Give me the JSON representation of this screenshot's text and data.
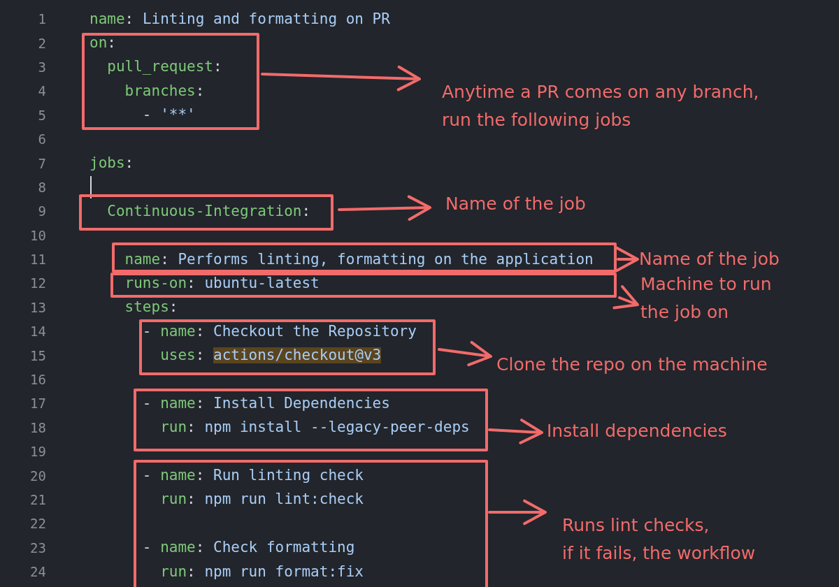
{
  "editor": {
    "lines": [
      {
        "number": "1",
        "tokens": [
          {
            "kind": "key",
            "text": "name"
          },
          {
            "kind": "punct",
            "text": ": "
          },
          {
            "kind": "value",
            "text": "Linting and formatting on PR"
          }
        ]
      },
      {
        "number": "2",
        "tokens": [
          {
            "kind": "key",
            "text": "on"
          },
          {
            "kind": "punct",
            "text": ":"
          }
        ]
      },
      {
        "number": "3",
        "tokens": [
          {
            "kind": "key",
            "text": "  pull_request"
          },
          {
            "kind": "punct",
            "text": ":"
          }
        ]
      },
      {
        "number": "4",
        "tokens": [
          {
            "kind": "key",
            "text": "    branches"
          },
          {
            "kind": "punct",
            "text": ":"
          }
        ]
      },
      {
        "number": "5",
        "tokens": [
          {
            "kind": "punct",
            "text": "      - "
          },
          {
            "kind": "value",
            "text": "'**'"
          }
        ]
      },
      {
        "number": "6"
      },
      {
        "number": "7",
        "tokens": [
          {
            "kind": "key",
            "text": "jobs"
          },
          {
            "kind": "punct",
            "text": ":"
          }
        ]
      },
      {
        "number": "8",
        "cursor": true
      },
      {
        "number": "9",
        "tokens": [
          {
            "kind": "key",
            "text": "  Continuous-Integration"
          },
          {
            "kind": "punct",
            "text": ":"
          }
        ]
      },
      {
        "number": "10"
      },
      {
        "number": "11",
        "tokens": [
          {
            "kind": "key",
            "text": "    name"
          },
          {
            "kind": "punct",
            "text": ": "
          },
          {
            "kind": "value",
            "text": "Performs linting, formatting on the application"
          }
        ]
      },
      {
        "number": "12",
        "tokens": [
          {
            "kind": "key",
            "text": "    runs-on"
          },
          {
            "kind": "punct",
            "text": ": "
          },
          {
            "kind": "value",
            "text": "ubuntu-latest"
          }
        ]
      },
      {
        "number": "13",
        "tokens": [
          {
            "kind": "key",
            "text": "    steps"
          },
          {
            "kind": "punct",
            "text": ":"
          }
        ]
      },
      {
        "number": "14",
        "tokens": [
          {
            "kind": "punct",
            "text": "      - "
          },
          {
            "kind": "key",
            "text": "name"
          },
          {
            "kind": "punct",
            "text": ": "
          },
          {
            "kind": "value",
            "text": "Checkout the Repository"
          }
        ]
      },
      {
        "number": "15",
        "tokens": [
          {
            "kind": "key",
            "text": "        uses"
          },
          {
            "kind": "punct",
            "text": ": "
          },
          {
            "kind": "value",
            "text": "actions/checkout@v3",
            "highlighted": true
          }
        ]
      },
      {
        "number": "16"
      },
      {
        "number": "17",
        "tokens": [
          {
            "kind": "punct",
            "text": "      - "
          },
          {
            "kind": "key",
            "text": "name"
          },
          {
            "kind": "punct",
            "text": ": "
          },
          {
            "kind": "value",
            "text": "Install Dependencies"
          }
        ]
      },
      {
        "number": "18",
        "tokens": [
          {
            "kind": "key",
            "text": "        run"
          },
          {
            "kind": "punct",
            "text": ": "
          },
          {
            "kind": "value",
            "text": "npm install --legacy-peer-deps"
          }
        ]
      },
      {
        "number": "19"
      },
      {
        "number": "20",
        "tokens": [
          {
            "kind": "punct",
            "text": "      - "
          },
          {
            "kind": "key",
            "text": "name"
          },
          {
            "kind": "punct",
            "text": ": "
          },
          {
            "kind": "value",
            "text": "Run linting check"
          }
        ]
      },
      {
        "number": "21",
        "tokens": [
          {
            "kind": "key",
            "text": "        run"
          },
          {
            "kind": "punct",
            "text": ": "
          },
          {
            "kind": "value",
            "text": "npm run lint:check"
          }
        ]
      },
      {
        "number": "22"
      },
      {
        "number": "23",
        "tokens": [
          {
            "kind": "punct",
            "text": "      - "
          },
          {
            "kind": "key",
            "text": "name"
          },
          {
            "kind": "punct",
            "text": ": "
          },
          {
            "kind": "value",
            "text": "Check formatting"
          }
        ]
      },
      {
        "number": "24",
        "tokens": [
          {
            "kind": "key",
            "text": "        run"
          },
          {
            "kind": "punct",
            "text": ": "
          },
          {
            "kind": "value",
            "text": "npm run format:fix"
          }
        ]
      }
    ]
  },
  "annotations": [
    {
      "lines": [
        "Anytime a PR comes on any branch,",
        "run the following jobs"
      ]
    },
    {
      "lines": [
        "Name of the job"
      ]
    },
    {
      "lines": [
        "Name of the job"
      ]
    },
    {
      "lines": [
        "Machine to run",
        "the job on"
      ]
    },
    {
      "lines": [
        "Clone the repo on the machine"
      ]
    },
    {
      "lines": [
        "Install dependencies"
      ]
    },
    {
      "lines": [
        "Runs lint checks,",
        "if it fails, the workflow"
      ]
    }
  ]
}
